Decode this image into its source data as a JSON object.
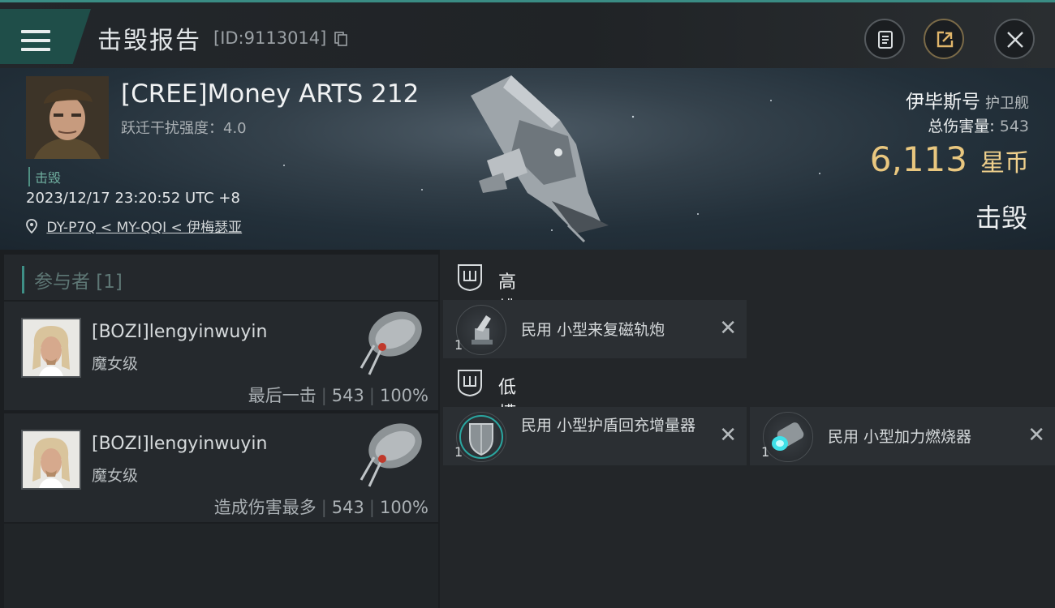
{
  "header": {
    "title": "击毁报告",
    "id_text": "[ID:9113014]"
  },
  "victim": {
    "name": "[CREE]Money ARTS 212",
    "warp_label": "跃迁干扰强度：4.0",
    "status": "击毁",
    "datetime": "2023/12/17 23:20:52 UTC +8",
    "location": "DY-P7Q < MY-QQI < 伊梅瑟亚"
  },
  "ship": {
    "name": "伊毕斯号",
    "class": "护卫舰",
    "total_damage_label": "总伤害量:",
    "total_damage": "543",
    "isk_value": "6,113",
    "isk_unit": "星币",
    "result": "击毁"
  },
  "participants": {
    "header": "参与者 [1]",
    "items": [
      {
        "name": "[BOZI]lengyinwuyin",
        "ship": "魔女级",
        "role": "最后一击",
        "damage": "543",
        "percent": "100%"
      },
      {
        "name": "[BOZI]lengyinwuyin",
        "ship": "魔女级",
        "role": "造成伤害最多",
        "damage": "543",
        "percent": "100%"
      }
    ]
  },
  "fittings": {
    "high_slot_label": "高槽",
    "low_slot_label": "低槽",
    "high_modules": [
      {
        "qty": "1",
        "name": "民用 小型来复磁轨炮",
        "icon": "railgun-icon"
      }
    ],
    "low_modules": [
      {
        "qty": "1",
        "name": "民用 小型护盾回充增量器",
        "icon": "shield-icon"
      },
      {
        "qty": "1",
        "name": "民用 小型加力燃烧器",
        "icon": "afterburner-icon"
      }
    ]
  },
  "colors": {
    "accent": "#3e8f86",
    "isk": "#e9c77f"
  }
}
